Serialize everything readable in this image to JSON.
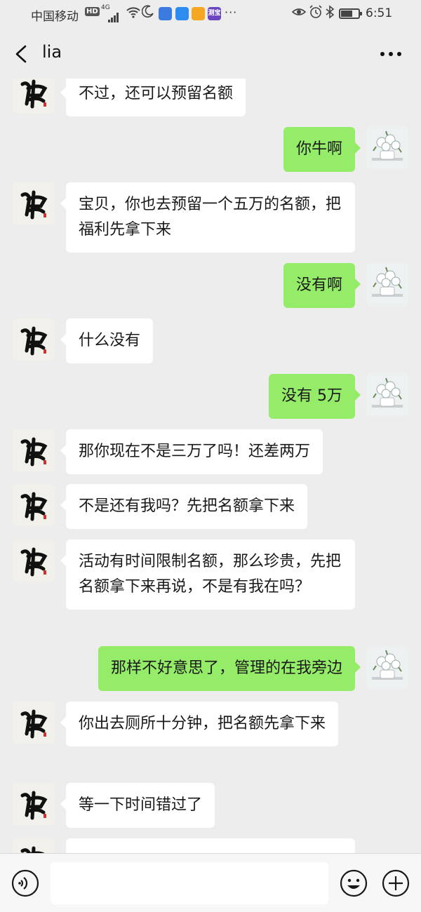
{
  "status_bar": {
    "carrier": "中国移动",
    "hd_badge": "HD",
    "network": "4G",
    "time": "6:51",
    "app_icons": [
      {
        "name": "app-icon-1",
        "color": "#3b7be0",
        "label": ""
      },
      {
        "name": "app-icon-2",
        "color": "#2d8cf0",
        "label": ""
      },
      {
        "name": "app-icon-3",
        "color": "#f5a623",
        "label": ""
      },
      {
        "name": "app-icon-4",
        "color": "#6b46c1",
        "label": "测宝"
      }
    ],
    "more_dots": "···"
  },
  "header": {
    "title": "lia"
  },
  "messages": [
    {
      "side": "left",
      "text": "不过，还可以预留名额"
    },
    {
      "side": "right",
      "text": "你牛啊"
    },
    {
      "side": "left",
      "text": "宝贝，你也去预留一个五万的名额，把福利先拿下来"
    },
    {
      "side": "right",
      "text": "没有啊"
    },
    {
      "side": "left",
      "text": "什么没有"
    },
    {
      "side": "right",
      "text": "没有 5万"
    },
    {
      "side": "left",
      "text": "那你现在不是三万了吗！还差两万"
    },
    {
      "side": "left",
      "text": "不是还有我吗？先把名额拿下来"
    },
    {
      "side": "left",
      "text": "活动有时间限制名额，那么珍贵，先把名额拿下来再说，不是有我在吗？"
    },
    {
      "side": "right",
      "text": "那样不好意思了，管理的在我旁边"
    },
    {
      "side": "left",
      "text": "你出去厕所十分钟，把名额先拿下来"
    },
    {
      "side": "left",
      "text": "等一下时间错过了"
    },
    {
      "side": "left",
      "text": ""
    }
  ],
  "input_bar": {
    "placeholder": "",
    "value": ""
  },
  "colors": {
    "background": "#ededed",
    "bubble_left": "#ffffff",
    "bubble_right": "#95ec69"
  }
}
